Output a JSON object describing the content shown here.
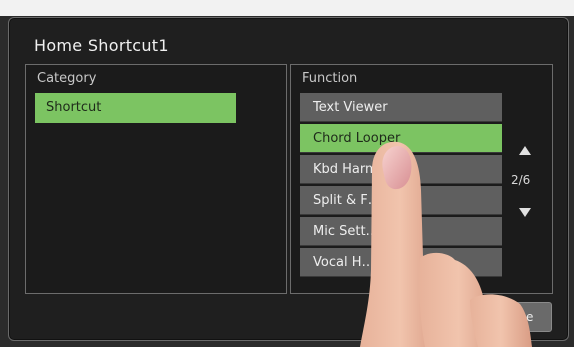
{
  "dialog": {
    "title": "Home Shortcut1"
  },
  "category": {
    "label": "Category",
    "items": [
      {
        "label": "Shortcut"
      }
    ]
  },
  "function": {
    "label": "Function",
    "items": [
      {
        "label": "Text Viewer"
      },
      {
        "label": "Chord Looper"
      },
      {
        "label": "Kbd Harm…Arp"
      },
      {
        "label": "Split & F…ing"
      },
      {
        "label": "Mic Sett…"
      },
      {
        "label": "Vocal H…"
      }
    ],
    "selected_index": 1
  },
  "pager": {
    "text": "2/6"
  },
  "buttons": {
    "close_label": "Close"
  },
  "colors": {
    "accent_green": "#7cc462",
    "item_gray": "#5f5f5f"
  }
}
